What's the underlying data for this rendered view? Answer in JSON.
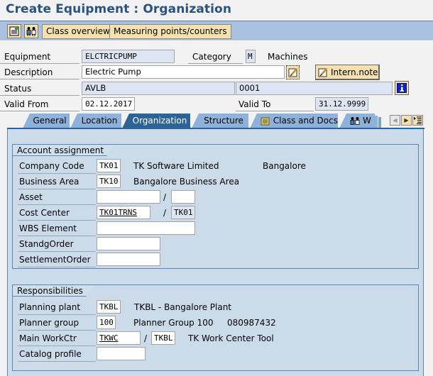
{
  "header": {
    "title": "Create Equipment : Organization"
  },
  "toolbar": {
    "icons": [
      "display-document-icon",
      "partners-icon"
    ],
    "class_overview": "Class overview",
    "measuring_points": "Measuring points/counters"
  },
  "form": {
    "equipment_label": "Equipment",
    "equipment_value": "ELCTRICPUMP",
    "category_label": "Category",
    "category_value": "M",
    "category_text": "Machines",
    "description_label": "Description",
    "description_value": "Electric Pump",
    "intern_note": "Intern.note",
    "status_label": "Status",
    "status_value": "AVLB",
    "status_number": "0001",
    "valid_from_label": "Valid From",
    "valid_from_value": "02.12.2017",
    "valid_to_label": "Valid To",
    "valid_to_value": "31.12.9999"
  },
  "tabs": [
    {
      "label": "General",
      "active": false
    },
    {
      "label": "Location",
      "active": false
    },
    {
      "label": "Organization",
      "active": true
    },
    {
      "label": "Structure",
      "active": false
    },
    {
      "label": "Class and Docs",
      "active": false
    },
    {
      "label": "W",
      "active": false
    }
  ],
  "account_assignment": {
    "title": "Account assignment",
    "company_code_label": "Company Code",
    "company_code_value": "TK01",
    "company_code_text": "TK Software Limited",
    "company_code_city": "Bangalore",
    "business_area_label": "Business Area",
    "business_area_value": "TK10",
    "business_area_text": "Bangalore Business Area",
    "asset_label": "Asset",
    "asset_value": "",
    "asset_sub_value": "",
    "cost_center_label": "Cost Center",
    "cost_center_value": "TK01TRNS",
    "cost_center_sub_value": "TK01",
    "wbs_label": "WBS Element",
    "wbs_value": "",
    "standg_order_label": "StandgOrder",
    "standg_order_value": "",
    "settlement_order_label": "SettlementOrder",
    "settlement_order_value": "",
    "separator": "/"
  },
  "responsibilities": {
    "title": "Responsibilities",
    "planning_plant_label": "Planning plant",
    "planning_plant_value": "TKBL",
    "planning_plant_text": "TKBL - Bangalore Plant",
    "planner_group_label": "Planner group",
    "planner_group_value": "100",
    "planner_group_text": "Planner Group 100",
    "planner_group_phone": "080987432",
    "main_workctr_label": "Main WorkCtr",
    "main_workctr_value": "TKWC",
    "main_workctr_plant": "TKBL",
    "main_workctr_text": "TK Work Center Tool",
    "catalog_profile_label": "Catalog profile",
    "catalog_profile_value": "",
    "separator": "/"
  }
}
